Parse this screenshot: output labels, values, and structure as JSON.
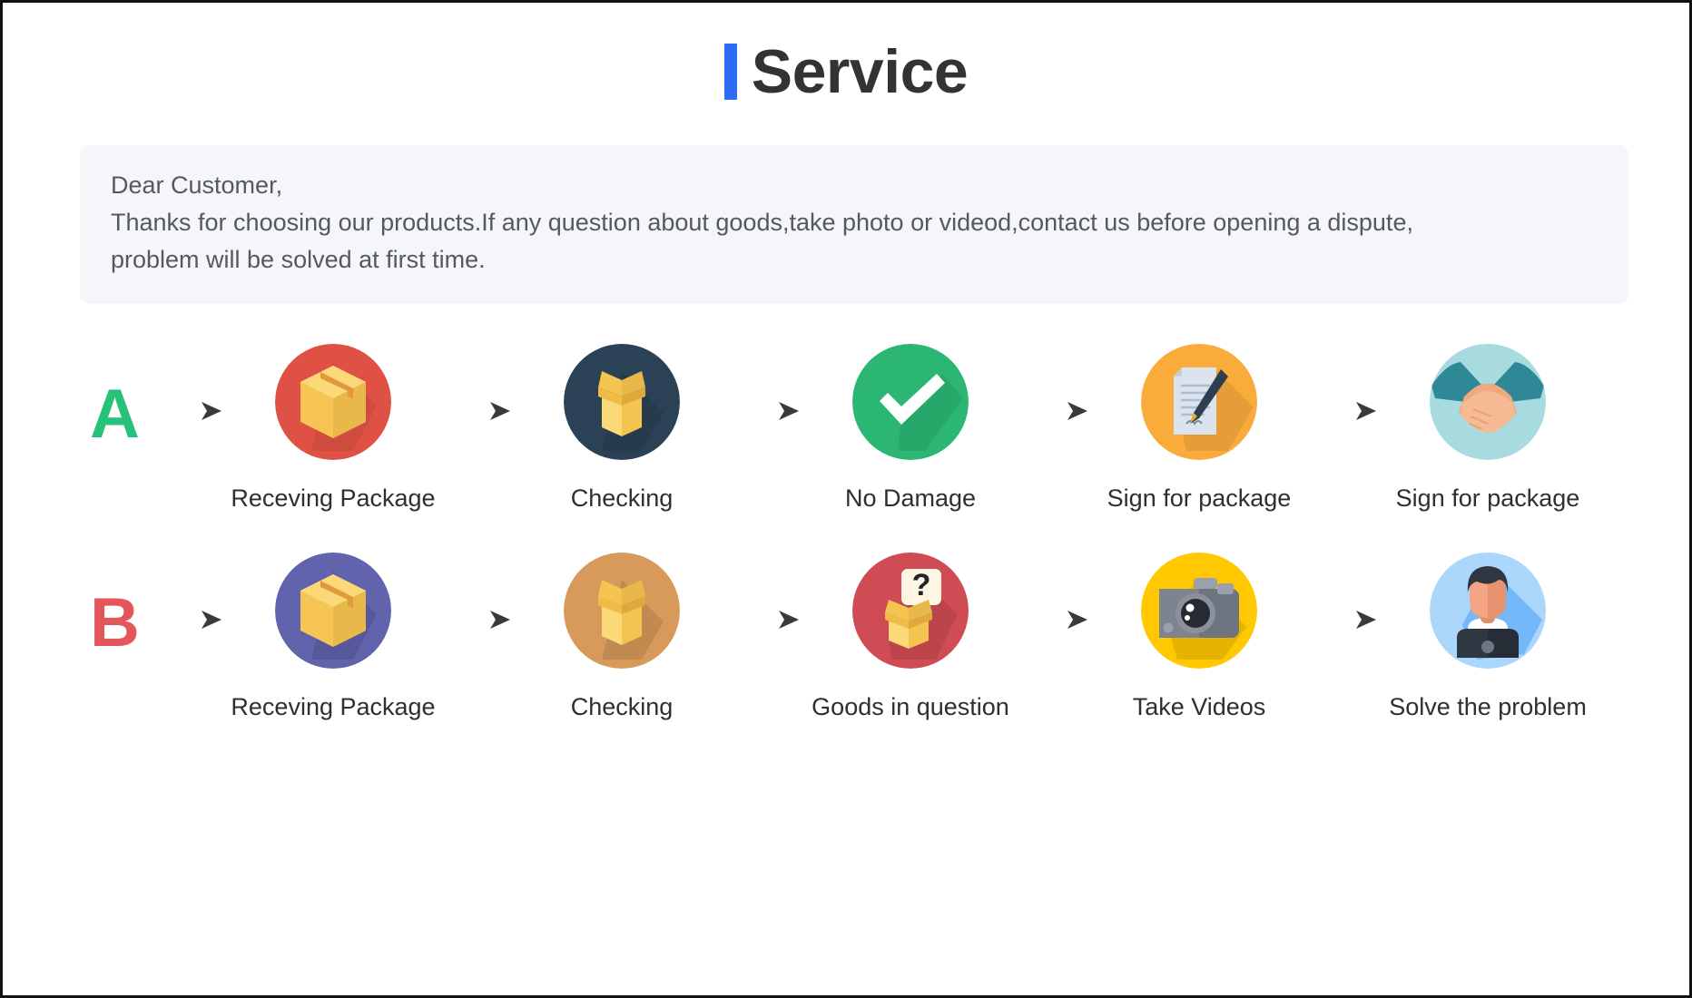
{
  "header": {
    "title": "Service",
    "accent_color": "#2d6df6",
    "title_color": "#333333"
  },
  "notice": {
    "background_color": "#f5f6fa",
    "text_color": "#55595f",
    "line1": "Dear Customer,",
    "line2": "Thanks for choosing our products.If any question about goods,take photo or videod,contact us before opening a dispute,",
    "line3": "problem will be solved at first time."
  },
  "flows": [
    {
      "letter": "A",
      "letter_color": "#27c27a",
      "steps": [
        {
          "label": "Receving Package",
          "icon": "closed-box-icon",
          "circle_color": "#e05145"
        },
        {
          "label": "Checking",
          "icon": "open-box-icon",
          "circle_color": "#2b4256"
        },
        {
          "label": "No Damage",
          "icon": "checkmark-icon",
          "circle_color": "#2bb673"
        },
        {
          "label": "Sign for package",
          "icon": "document-pen-icon",
          "circle_color": "#f9ab3c"
        },
        {
          "label": "Sign for package",
          "icon": "handshake-icon",
          "circle_color": "#a8dbe0"
        }
      ]
    },
    {
      "letter": "B",
      "letter_color": "#e2565c",
      "steps": [
        {
          "label": "Receving Package",
          "icon": "closed-box-icon",
          "circle_color": "#6163ad"
        },
        {
          "label": "Checking",
          "icon": "open-box-icon",
          "circle_color": "#d79a5b"
        },
        {
          "label": "Goods in question",
          "icon": "box-question-icon",
          "circle_color": "#cf4c54"
        },
        {
          "label": "Take Videos",
          "icon": "camera-icon",
          "circle_color": "#ffc800"
        },
        {
          "label": "Solve the problem",
          "icon": "support-agent-icon",
          "circle_color": "#aad7fb"
        }
      ]
    }
  ],
  "arrow": {
    "icon": "arrow-right-icon",
    "color": "#4a4a4a"
  }
}
